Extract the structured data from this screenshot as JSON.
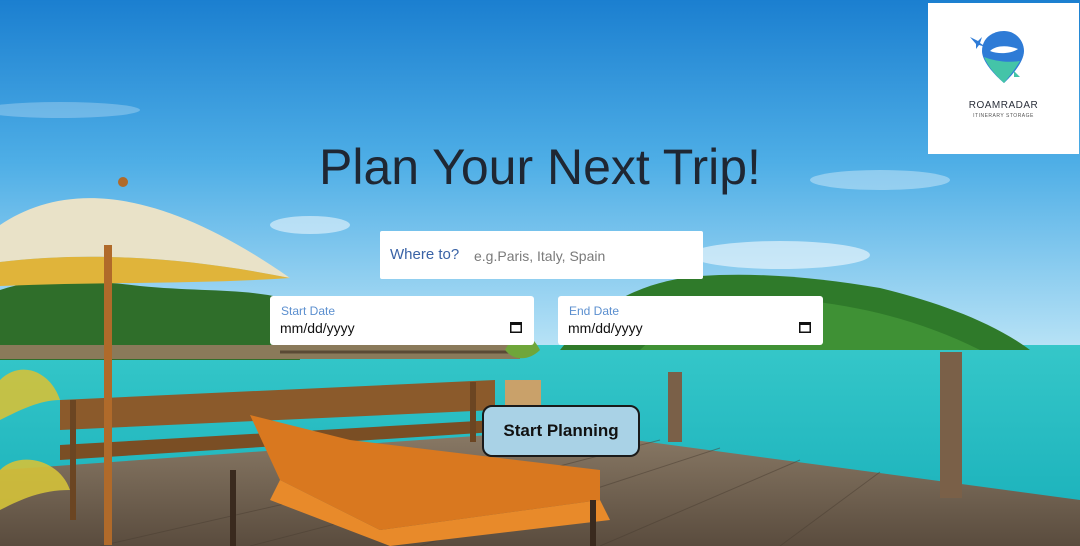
{
  "brand": {
    "name": "ROAMRADAR",
    "tagline": "ITINERARY STORAGE",
    "logo_icon": "map-pin-plane-logo"
  },
  "hero": {
    "title": "Plan Your Next Trip!"
  },
  "search": {
    "where_label": "Where to?",
    "where_placeholder": "e.g.Paris, Italy, Spain",
    "where_value": ""
  },
  "dates": {
    "start_label": "Start Date",
    "start_value": "mm/dd/yyyy",
    "end_label": "End Date",
    "end_value": "mm/dd/yyyy",
    "icon": "calendar-icon"
  },
  "actions": {
    "start_planning_label": "Start Planning"
  },
  "colors": {
    "title_text": "#1f2733",
    "label_blue": "#3a63a6",
    "button_bg": "#a9d2e6",
    "button_border": "#1a1a1a"
  }
}
